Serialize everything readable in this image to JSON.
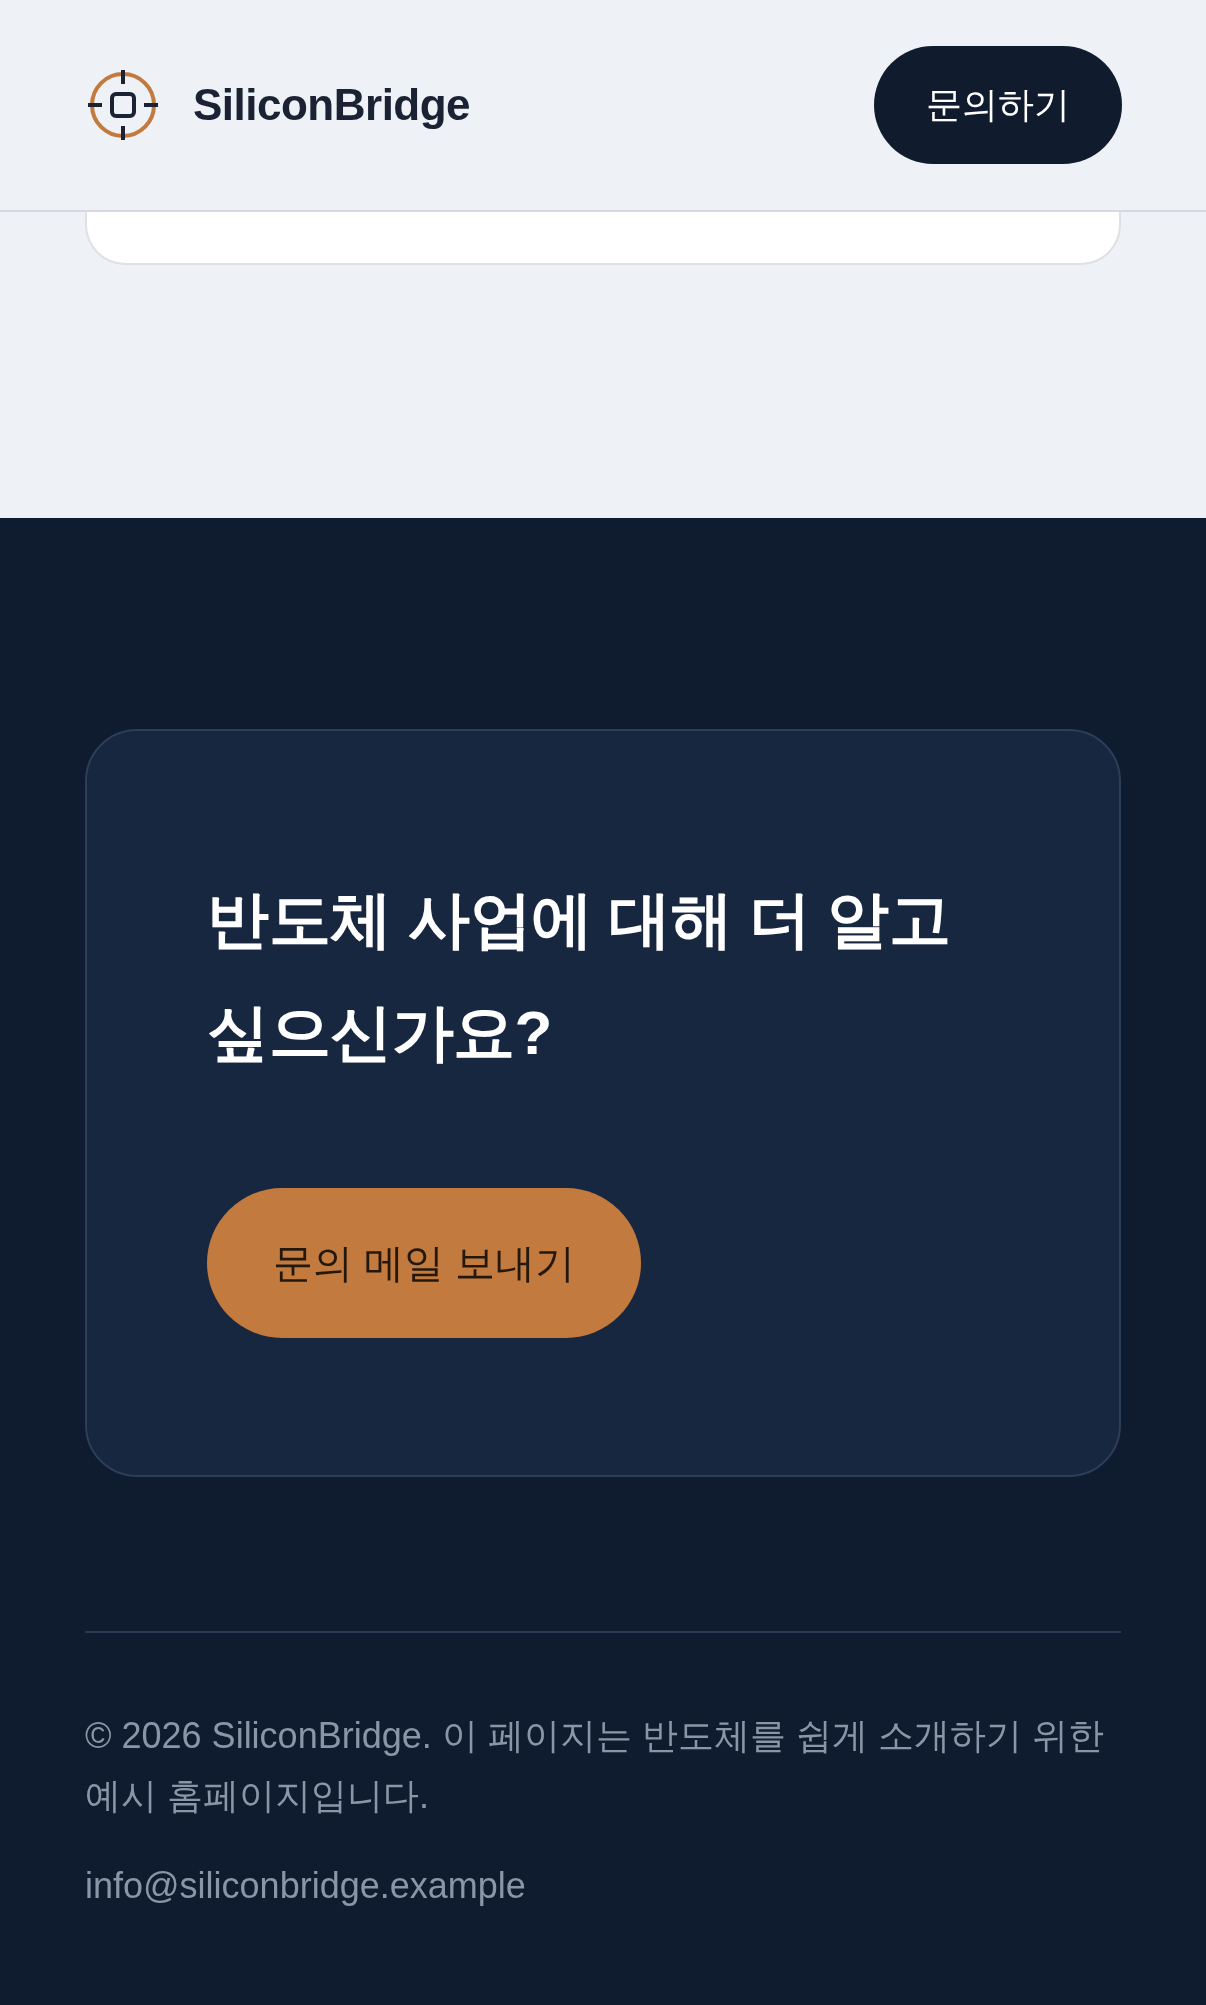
{
  "header": {
    "brand": "SiliconBridge",
    "button": "문의하기"
  },
  "cta": {
    "heading": "반도체 사업에 대해 더 알고 싶으신가요?",
    "button": "문의 메일 보내기"
  },
  "footer": {
    "notice": "© 2026 SiliconBridge. 이 페이지는 반도체를 쉽게 소개하기 위한 예시 홈페이지입니다.",
    "email": "info@siliconbridge.example"
  }
}
